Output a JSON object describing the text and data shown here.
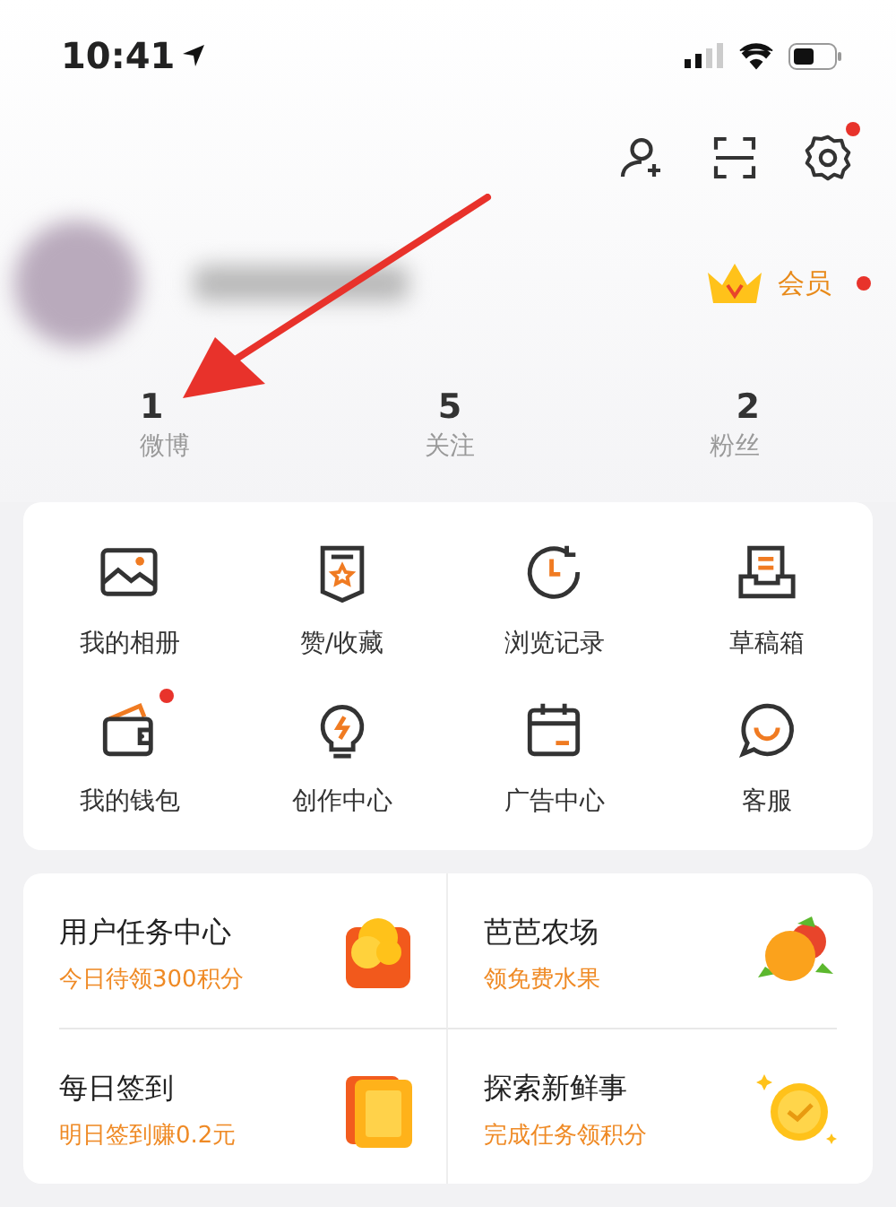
{
  "status_bar": {
    "time": "10:41"
  },
  "header": {
    "settings_dot": true
  },
  "profile": {
    "vip": {
      "label": "会员",
      "dot": true
    }
  },
  "stats": [
    {
      "value": "1",
      "label": "微博"
    },
    {
      "value": "5",
      "label": "关注"
    },
    {
      "value": "2",
      "label": "粉丝"
    }
  ],
  "shortcuts": [
    {
      "label": "我的相册",
      "dot": false
    },
    {
      "label": "赞/收藏",
      "dot": false
    },
    {
      "label": "浏览记录",
      "dot": false
    },
    {
      "label": "草稿箱",
      "dot": false
    },
    {
      "label": "我的钱包",
      "dot": true
    },
    {
      "label": "创作中心",
      "dot": false
    },
    {
      "label": "广告中心",
      "dot": false
    },
    {
      "label": "客服",
      "dot": false
    }
  ],
  "tasks": [
    {
      "title": "用户任务中心",
      "subtitle": "今日待领300积分"
    },
    {
      "title": "芭芭农场",
      "subtitle": "领免费水果"
    },
    {
      "title": "每日签到",
      "subtitle": "明日签到赚0.2元"
    },
    {
      "title": "探索新鲜事",
      "subtitle": "完成任务领积分"
    }
  ]
}
